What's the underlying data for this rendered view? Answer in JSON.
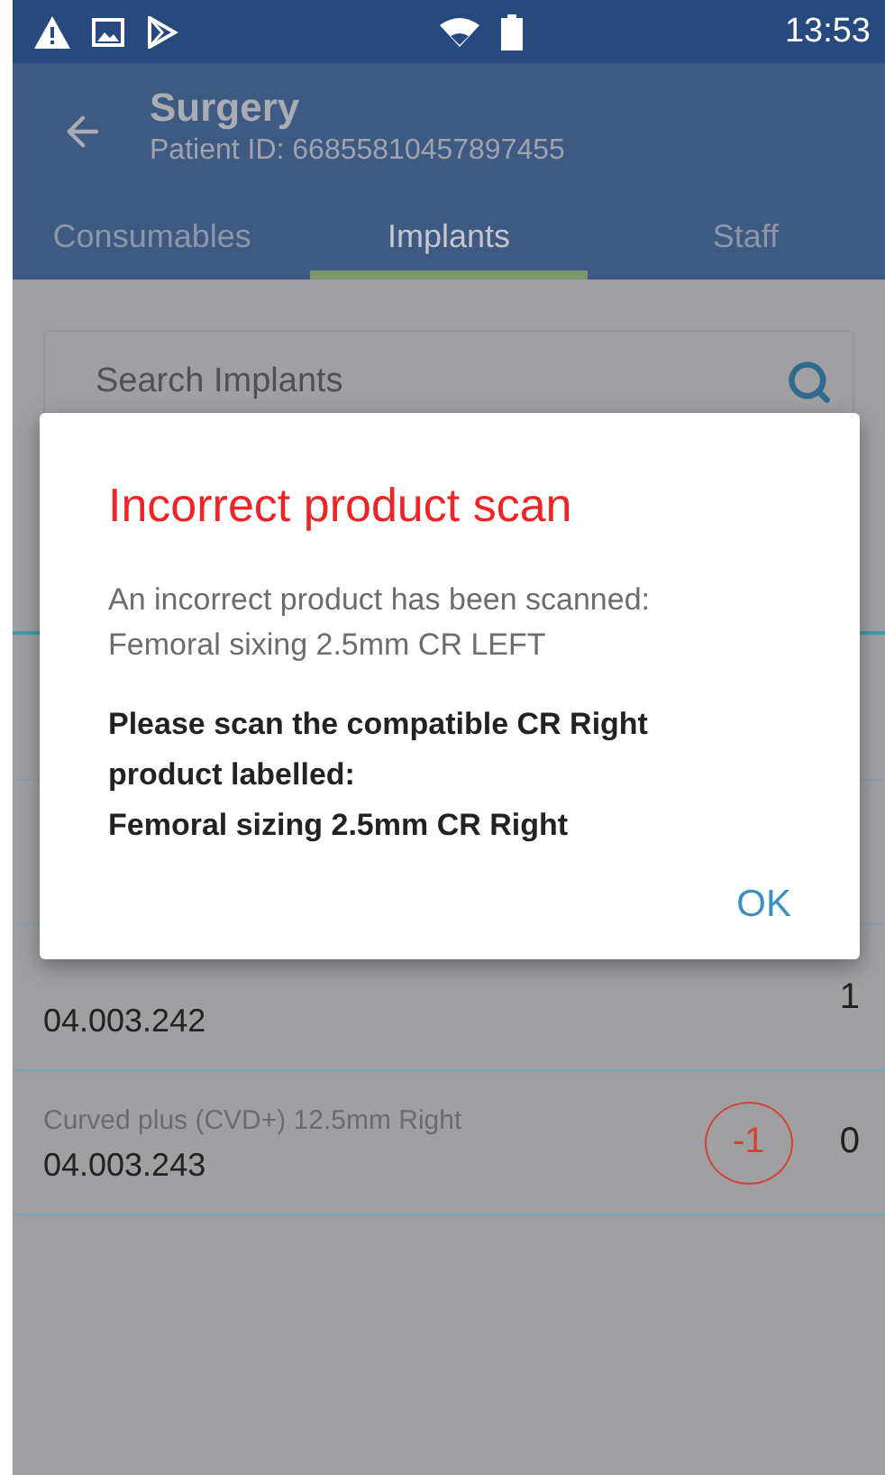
{
  "status_bar": {
    "time": "13:53"
  },
  "header": {
    "title": "Surgery",
    "subtitle": "Patient ID: 66855810457897455"
  },
  "tabs": [
    {
      "label": "Consumables",
      "selected": false
    },
    {
      "label": "Implants",
      "selected": true
    },
    {
      "label": "Staff",
      "selected": false
    }
  ],
  "search": {
    "placeholder": "Search Implants"
  },
  "rows": [
    {
      "code": "04.003.242",
      "count": "1"
    },
    {
      "name": "Curved plus (CVD+) 12.5mm Right",
      "code": "04.003.243",
      "adjust": "-1",
      "count": "0"
    }
  ],
  "dialog": {
    "title": "Incorrect product scan",
    "message": "An incorrect product has been scanned: Femoral sixing 2.5mm CR LEFT",
    "instruction": "Please scan the compatible CR Right product labelled:\nFemoral sizing 2.5mm CR Right",
    "button": "OK"
  }
}
